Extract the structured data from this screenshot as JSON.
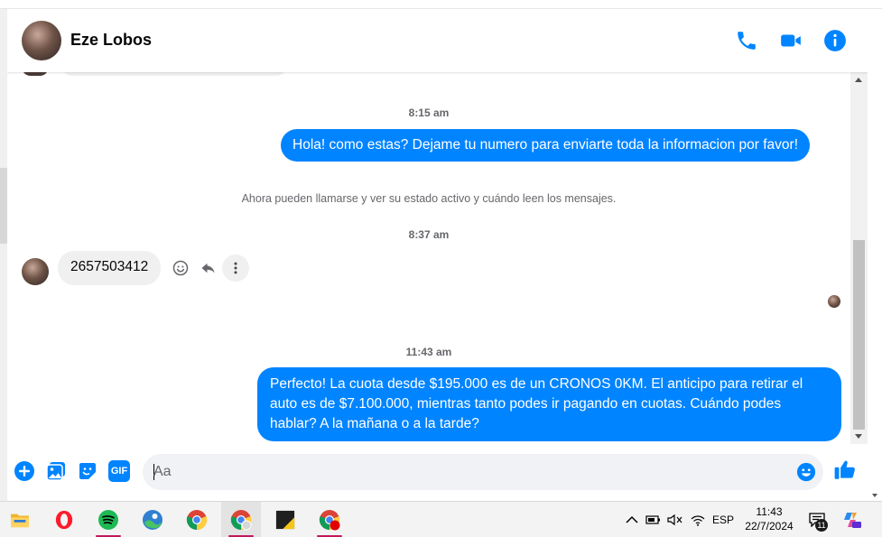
{
  "contact": {
    "name": "Eze Lobos"
  },
  "colors": {
    "accent": "#0084ff",
    "incoming_bubble": "#f0f0f0",
    "meta_text": "#65676b"
  },
  "header_icons": [
    "phone-icon",
    "video-camera-icon",
    "info-icon"
  ],
  "messages": {
    "timestamp_1": "8:15 am",
    "outgoing_1": "Hola! como estas? Dejame tu numero para enviarte toda la informacion por favor!",
    "notice": "Ahora pueden llamarse y ver su estado activo y cuándo leen los mensajes.",
    "timestamp_2": "8:37 am",
    "incoming_1": "2657503412",
    "timestamp_3": "11:43 am",
    "outgoing_2": "Perfecto! La cuota desde $195.000 es de un CRONOS 0KM. El anticipo para retirar el auto es de $7.100.000, mientras tanto podes ir pagando en cuotas. Cuándo podes hablar? A la mañana o a la tarde?"
  },
  "composer": {
    "placeholder": "Aa",
    "gif_label": "GIF",
    "icons": [
      "plus-icon",
      "image-icon",
      "sticker-icon",
      "gif-icon",
      "emoji-icon",
      "like-icon"
    ]
  },
  "taskbar": {
    "apps": [
      "file-explorer-icon",
      "opera-icon",
      "spotify-icon",
      "photos-icon",
      "chrome-icon",
      "chrome-profile-icon",
      "sticky-app-icon",
      "chrome-record-icon"
    ],
    "language": "ESP",
    "time": "11:43",
    "date": "22/7/2024",
    "notification_count": "11"
  }
}
